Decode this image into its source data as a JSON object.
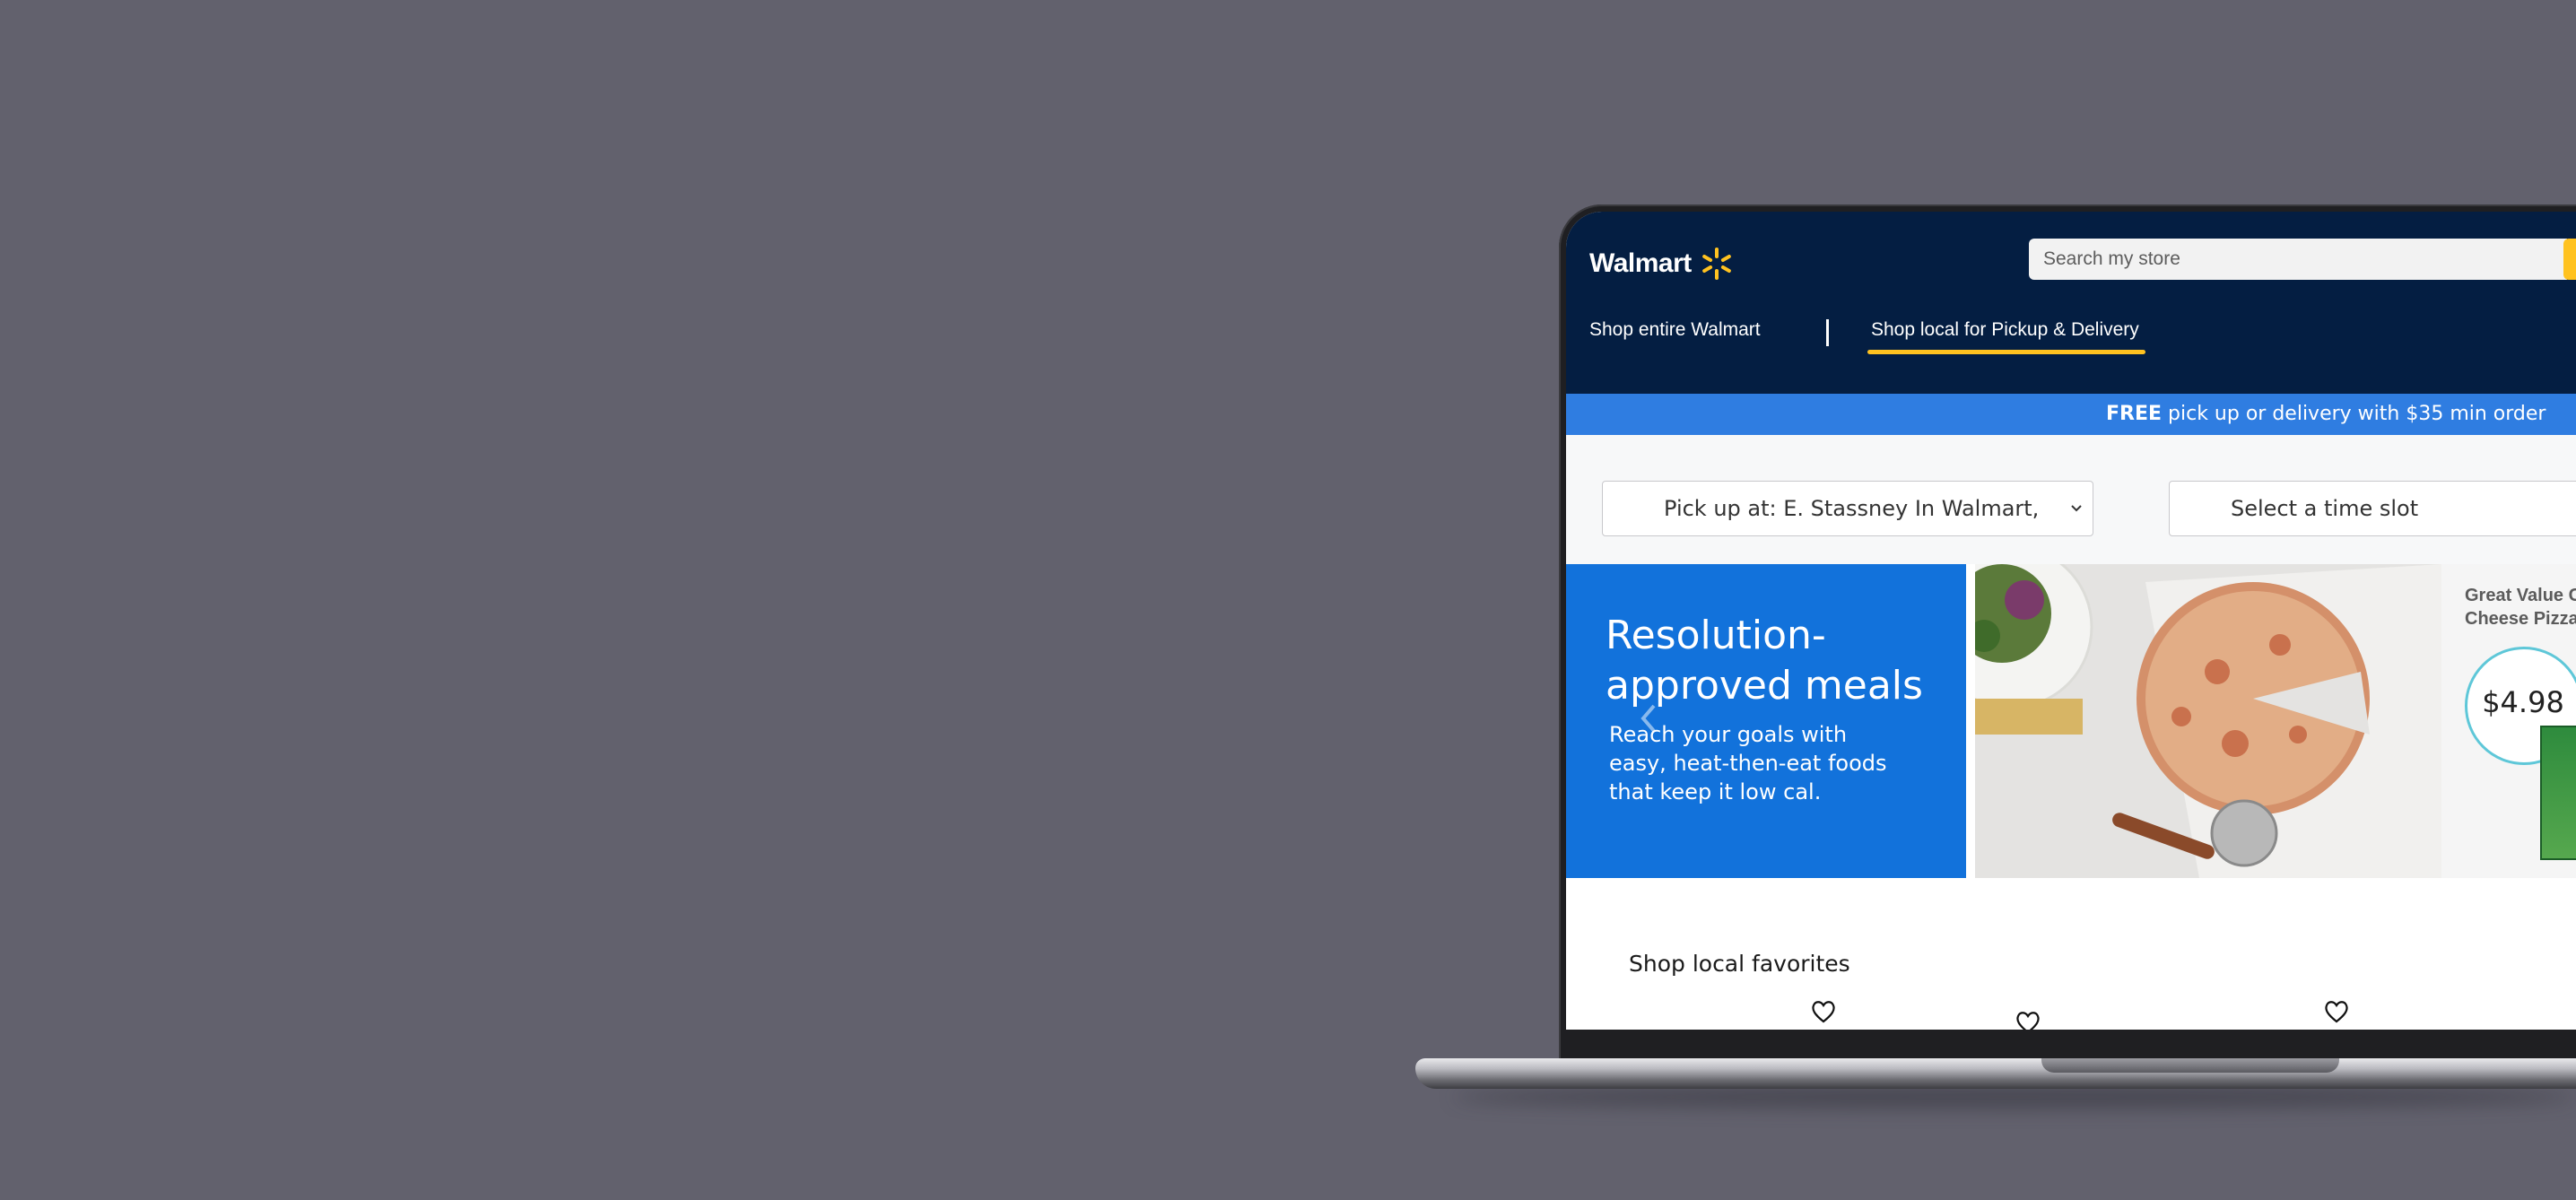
{
  "header": {
    "logo_text": "Walmart",
    "search_placeholder": "Search my store",
    "nav_shop_entire": "Shop entire Walmart",
    "nav_shop_local": "Shop local for Pickup & Delivery"
  },
  "promo": {
    "bold": "FREE",
    "text": " pick up or delivery with $35 min order"
  },
  "pickup": {
    "store_select": "Pick up at: E. Stassney In Walmart,",
    "time_slot": "Select a time slot"
  },
  "hero": {
    "title": "Resolution-approved meals",
    "subtitle": "Reach your goals with easy, heat-then-eat foods that keep it low cal.",
    "product_name_line1": "Great Value C",
    "product_name_line2": "Cheese Pizza",
    "price": "$4.98"
  },
  "favorites": {
    "title": "Shop local favorites"
  },
  "colors": {
    "walmart_navy": "#041e42",
    "walmart_blue": "#1272db",
    "promo_blue": "#2f7de1",
    "spark_yellow": "#ffc220",
    "price_ring": "#5ec7d8"
  },
  "icons": [
    "walmart-spark-icon",
    "chevron-down-icon",
    "chevron-left-icon",
    "heart-icon"
  ]
}
